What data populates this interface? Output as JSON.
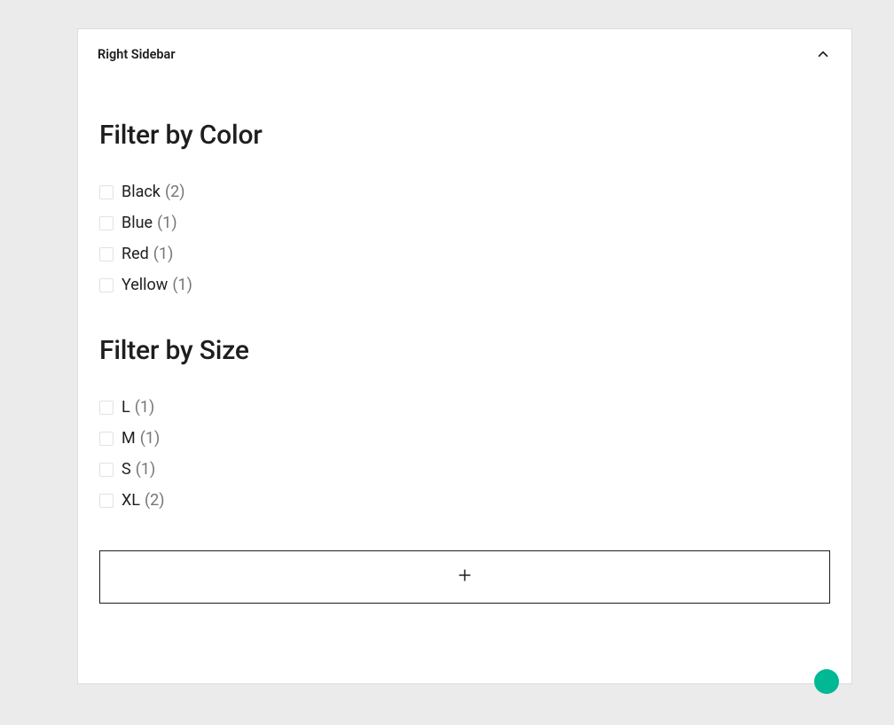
{
  "panel": {
    "title": "Right Sidebar"
  },
  "sections": [
    {
      "heading": "Filter by Color",
      "items": [
        {
          "label": "Black",
          "count": "(2)"
        },
        {
          "label": "Blue",
          "count": "(1)"
        },
        {
          "label": "Red",
          "count": "(1)"
        },
        {
          "label": "Yellow",
          "count": "(1)"
        }
      ]
    },
    {
      "heading": "Filter by Size",
      "items": [
        {
          "label": "L",
          "count": "(1)"
        },
        {
          "label": "M",
          "count": "(1)"
        },
        {
          "label": "S",
          "count": "(1)"
        },
        {
          "label": "XL",
          "count": "(2)"
        }
      ]
    }
  ]
}
